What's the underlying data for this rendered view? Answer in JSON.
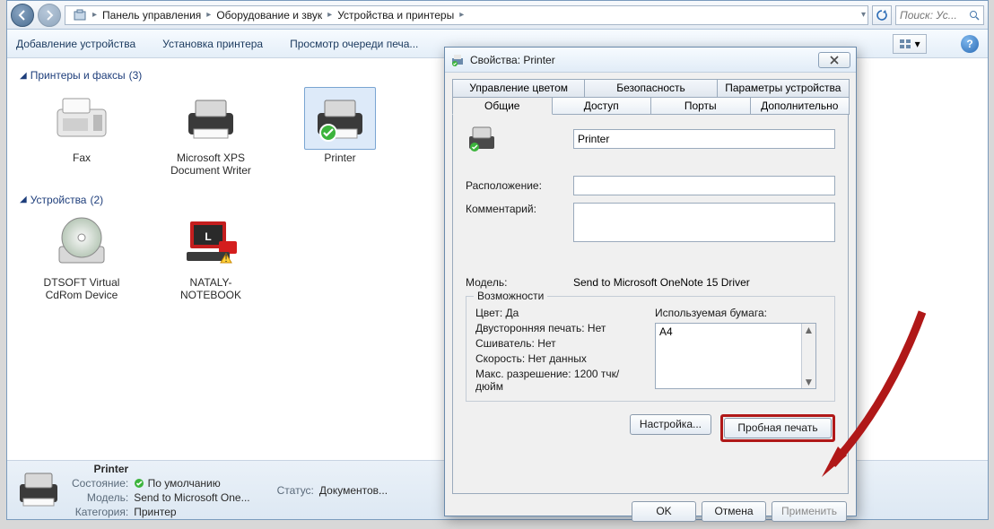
{
  "breadcrumbs": [
    "Панель управления",
    "Оборудование и звук",
    "Устройства и принтеры"
  ],
  "search": {
    "placeholder": "Поиск: Ус..."
  },
  "cmdbar": {
    "add_device": "Добавление устройства",
    "add_printer": "Установка принтера",
    "show_queue": "Просмотр очереди печа..."
  },
  "groups": {
    "printers": {
      "title": "Принтеры и факсы",
      "count": "(3)"
    },
    "devices": {
      "title": "Устройства",
      "count": "(2)"
    }
  },
  "items": {
    "fax": "Fax",
    "xps": "Microsoft XPS Document Writer",
    "printer": "Printer",
    "dtsoft": "DTSOFT Virtual CdRom Device",
    "nataly": "NATALY-NOTEBOOK"
  },
  "details": {
    "name": "Printer",
    "state_k": "Состояние:",
    "state_v": "По умолчанию",
    "status_k": "Статус:",
    "status_v": "Документов...",
    "model_k": "Модель:",
    "model_v": "Send to Microsoft One...",
    "cat_k": "Категория:",
    "cat_v": "Принтер"
  },
  "dialog": {
    "title": "Свойства: Printer",
    "tabs_back": [
      "Управление цветом",
      "Безопасность",
      "Параметры устройства"
    ],
    "tabs_front": [
      "Общие",
      "Доступ",
      "Порты",
      "Дополнительно"
    ],
    "name_value": "Printer",
    "location_label": "Расположение:",
    "comment_label": "Комментарий:",
    "model_label": "Модель:",
    "model_value": "Send to Microsoft OneNote 15 Driver",
    "caps": {
      "legend": "Возможности",
      "color": "Цвет: Да",
      "duplex": "Двусторонняя печать: Нет",
      "stapler": "Сшиватель: Нет",
      "speed": "Скорость: Нет данных",
      "maxres": "Макс. разрешение: 1200 тчк/дюйм",
      "paper_label": "Используемая бумага:",
      "paper_item": "A4"
    },
    "btn_settings": "Настройка...",
    "btn_testprint": "Пробная печать",
    "btn_ok": "OK",
    "btn_cancel": "Отмена",
    "btn_apply": "Применить"
  }
}
